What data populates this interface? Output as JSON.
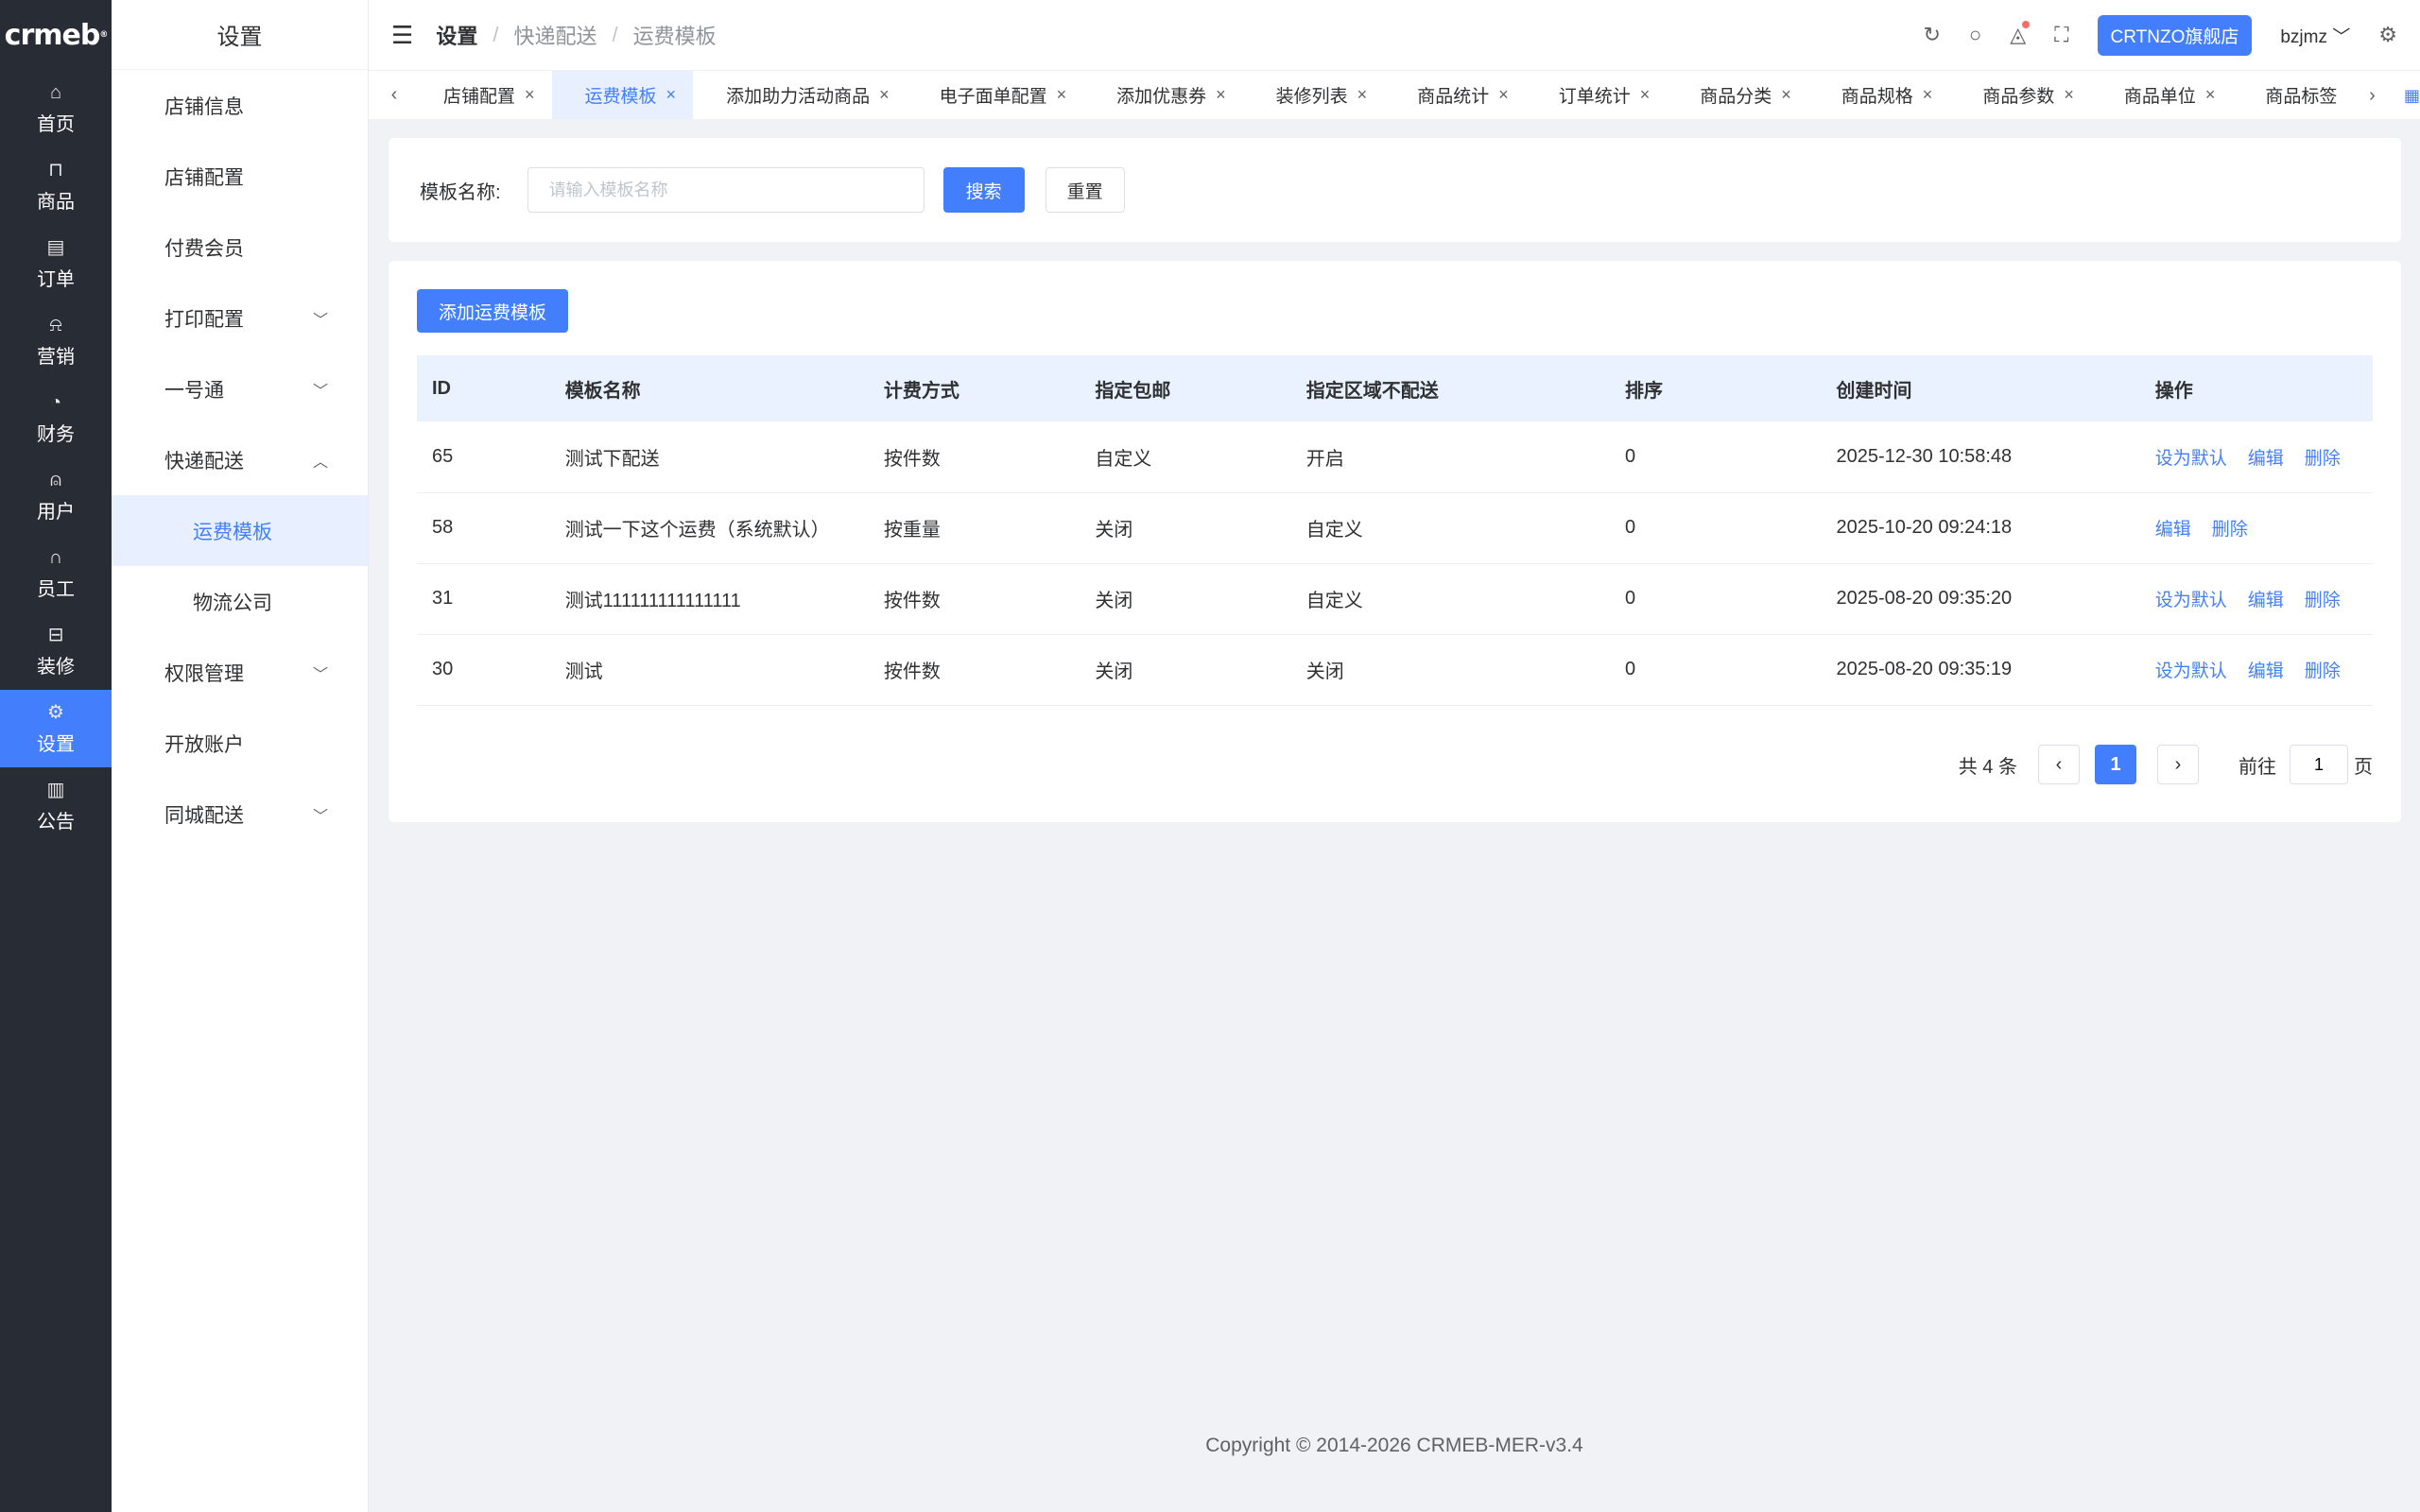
{
  "brand": {
    "logo_text": "crmeb",
    "logo_mark": "®"
  },
  "rail": [
    {
      "label": "首页",
      "icon": "home-icon",
      "glyph": "⌂"
    },
    {
      "label": "商品",
      "icon": "bag-icon",
      "glyph": "⊓"
    },
    {
      "label": "订单",
      "icon": "order-icon",
      "glyph": "▤"
    },
    {
      "label": "营销",
      "icon": "bell-icon",
      "glyph": "⍾"
    },
    {
      "label": "财务",
      "icon": "finance-icon",
      "glyph": "◔"
    },
    {
      "label": "用户",
      "icon": "user-icon",
      "glyph": "⍝"
    },
    {
      "label": "员工",
      "icon": "headset-icon",
      "glyph": "∩"
    },
    {
      "label": "装修",
      "icon": "decorate-icon",
      "glyph": "⊟"
    },
    {
      "label": "设置",
      "icon": "settings-icon",
      "glyph": "⚙"
    },
    {
      "label": "公告",
      "icon": "notice-icon",
      "glyph": "▥"
    }
  ],
  "submenu": {
    "title": "设置",
    "items": [
      {
        "label": "店铺信息",
        "chevron": ""
      },
      {
        "label": "店铺配置",
        "chevron": ""
      },
      {
        "label": "付费会员",
        "chevron": ""
      },
      {
        "label": "打印配置",
        "chevron": "﹀"
      },
      {
        "label": "一号通",
        "chevron": "﹀"
      },
      {
        "label": "快递配送",
        "chevron": "︿"
      },
      {
        "label": "运费模板",
        "chevron": ""
      },
      {
        "label": "物流公司",
        "chevron": ""
      },
      {
        "label": "权限管理",
        "chevron": "﹀"
      },
      {
        "label": "开放账户",
        "chevron": ""
      },
      {
        "label": "同城配送",
        "chevron": "﹀"
      }
    ]
  },
  "header": {
    "breadcrumb": [
      "设置",
      "快递配送",
      "运费模板"
    ],
    "sep": "/",
    "store_button": "CRTNZO旗舰店",
    "user": "bzjmz",
    "user_chevron": "﹀"
  },
  "tabs": [
    {
      "label": "店铺配置"
    },
    {
      "label": "运费模板"
    },
    {
      "label": "添加助力活动商品"
    },
    {
      "label": "电子面单配置"
    },
    {
      "label": "添加优惠券"
    },
    {
      "label": "装修列表"
    },
    {
      "label": "商品统计"
    },
    {
      "label": "订单统计"
    },
    {
      "label": "商品分类"
    },
    {
      "label": "商品规格"
    },
    {
      "label": "商品参数"
    },
    {
      "label": "商品单位"
    },
    {
      "label": "商品标签"
    }
  ],
  "search": {
    "label": "模板名称:",
    "placeholder": "请输入模板名称",
    "search_button": "搜索",
    "reset_button": "重置"
  },
  "table": {
    "add_button": "添加运费模板",
    "columns": [
      "ID",
      "模板名称",
      "计费方式",
      "指定包邮",
      "指定区域不配送",
      "排序",
      "创建时间",
      "操作"
    ],
    "rows": [
      {
        "id": "65",
        "name": "测试下配送",
        "billing": "按件数",
        "free": "自定义",
        "no_delivery": "开启",
        "sort": "0",
        "created": "2025-12-30 10:58:48",
        "ops": [
          "设为默认",
          "编辑",
          "删除"
        ]
      },
      {
        "id": "58",
        "name": "测试一下这个运费（系统默认）",
        "billing": "按重量",
        "free": "关闭",
        "no_delivery": "自定义",
        "sort": "0",
        "created": "2025-10-20 09:24:18",
        "ops": [
          "编辑",
          "删除"
        ]
      },
      {
        "id": "31",
        "name": "测试111111111111111",
        "billing": "按件数",
        "free": "关闭",
        "no_delivery": "自定义",
        "sort": "0",
        "created": "2025-08-20 09:35:20",
        "ops": [
          "设为默认",
          "编辑",
          "删除"
        ]
      },
      {
        "id": "30",
        "name": "测试",
        "billing": "按件数",
        "free": "关闭",
        "no_delivery": "关闭",
        "sort": "0",
        "created": "2025-08-20 09:35:19",
        "ops": [
          "设为默认",
          "编辑",
          "删除"
        ]
      }
    ]
  },
  "pager": {
    "total": "共 4 条",
    "current": "1",
    "goto": "前往",
    "goto_value": "1",
    "page_unit": "页"
  },
  "footer": "Copyright © 2014-2026 CRMEB-MER-v3.4",
  "colors": {
    "primary": "#437ffd",
    "rail_bg": "#282c34",
    "page_bg": "#f0f2f5"
  }
}
